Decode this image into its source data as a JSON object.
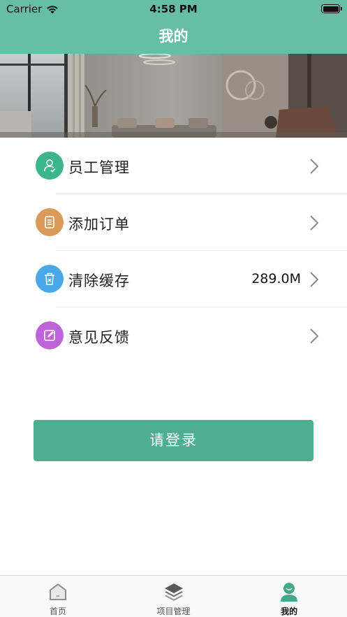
{
  "status_bar": {
    "carrier": "Carrier",
    "time": "4:58 PM"
  },
  "nav": {
    "title": "我的"
  },
  "menu": {
    "items": [
      {
        "label": "员工管理",
        "value": "",
        "icon": "staff-check-icon",
        "color": "#3cb48c"
      },
      {
        "label": "添加订单",
        "value": "",
        "icon": "order-doc-icon",
        "color": "#d99a5a"
      },
      {
        "label": "清除缓存",
        "value": "289.0M",
        "icon": "trash-icon",
        "color": "#4aa7e8"
      },
      {
        "label": "意见反馈",
        "value": "",
        "icon": "edit-icon",
        "color": "#bf63da"
      }
    ]
  },
  "login": {
    "label": "请登录"
  },
  "tabs": [
    {
      "label": "首页",
      "icon": "home-icon"
    },
    {
      "label": "项目管理",
      "icon": "layers-icon"
    },
    {
      "label": "我的",
      "icon": "profile-icon",
      "active": true
    }
  ],
  "colors": {
    "brand": "#66bea5",
    "button": "#4daf8f"
  }
}
